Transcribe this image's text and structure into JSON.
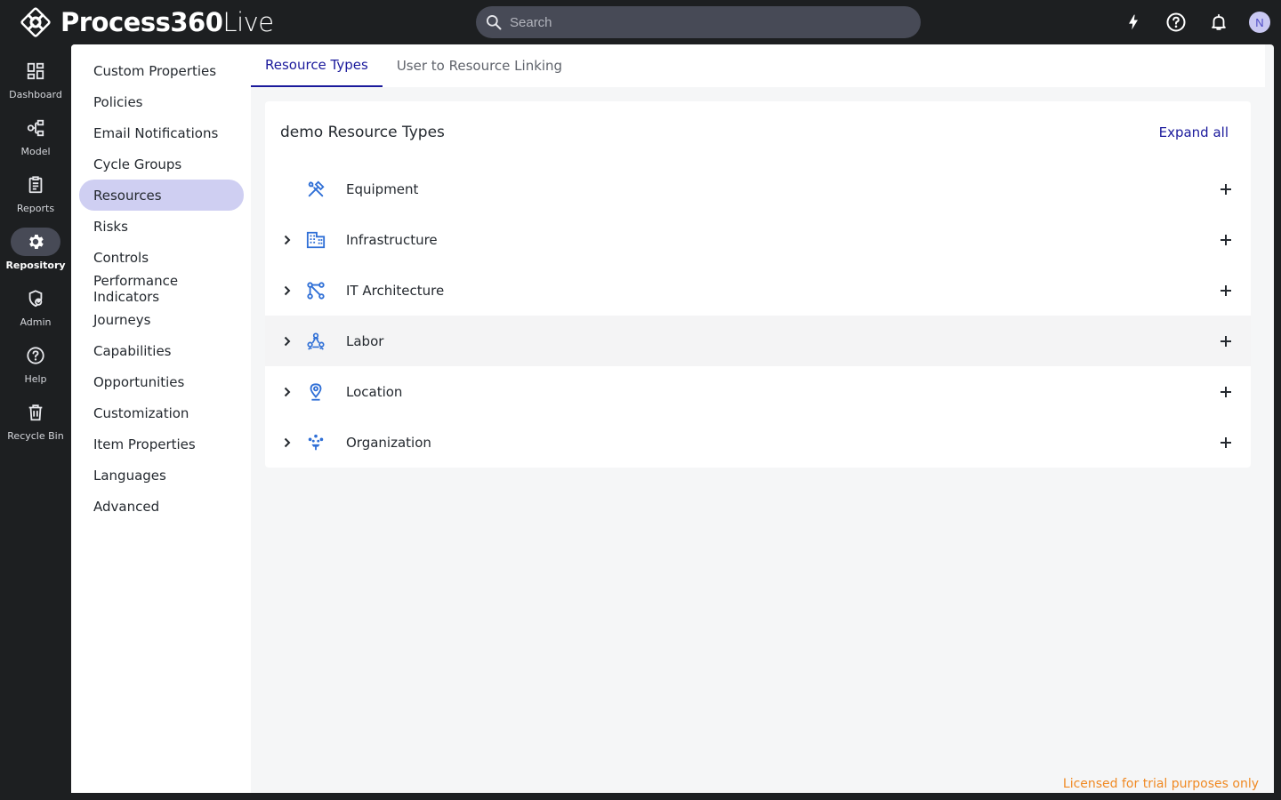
{
  "app": {
    "logo_bold": "Process360",
    "logo_light": "Live"
  },
  "search": {
    "placeholder": "Search"
  },
  "user": {
    "avatar_initial": "N"
  },
  "rail": [
    {
      "label": "Dashboard",
      "icon": "dashboard-icon"
    },
    {
      "label": "Model",
      "icon": "model-icon"
    },
    {
      "label": "Reports",
      "icon": "reports-icon"
    },
    {
      "label": "Repository",
      "icon": "gear-icon",
      "active": true
    },
    {
      "label": "Admin",
      "icon": "admin-shield-icon"
    },
    {
      "label": "Help",
      "icon": "help-icon"
    },
    {
      "label": "Recycle Bin",
      "icon": "trash-icon"
    }
  ],
  "subnav": [
    "Custom Properties",
    "Policies",
    "Email Notifications",
    "Cycle Groups",
    "Resources",
    "Risks",
    "Controls",
    "Performance Indicators",
    "Journeys",
    "Capabilities",
    "Opportunities",
    "Customization",
    "Item Properties",
    "Languages",
    "Advanced"
  ],
  "subnav_active": "Resources",
  "tabs": [
    {
      "label": "Resource Types",
      "active": true
    },
    {
      "label": "User to Resource Linking"
    }
  ],
  "card": {
    "title": "demo Resource Types",
    "expand_all": "Expand all",
    "rows": [
      {
        "label": "Equipment",
        "icon": "tools-icon",
        "expandable": false
      },
      {
        "label": "Infrastructure",
        "icon": "building-icon",
        "expandable": true
      },
      {
        "label": "IT Architecture",
        "icon": "network-icon",
        "expandable": true
      },
      {
        "label": "Labor",
        "icon": "people-icon",
        "expandable": true
      },
      {
        "label": "Location",
        "icon": "location-pin-icon",
        "expandable": true
      },
      {
        "label": "Organization",
        "icon": "organization-icon",
        "expandable": true
      }
    ]
  },
  "footer": {
    "license": "Licensed for trial purposes only"
  },
  "colors": {
    "accent": "#1b1a9c",
    "active_nav_bg": "#cfcff2",
    "icon_blue": "#2f6fd6",
    "license_orange": "#f08a24"
  }
}
